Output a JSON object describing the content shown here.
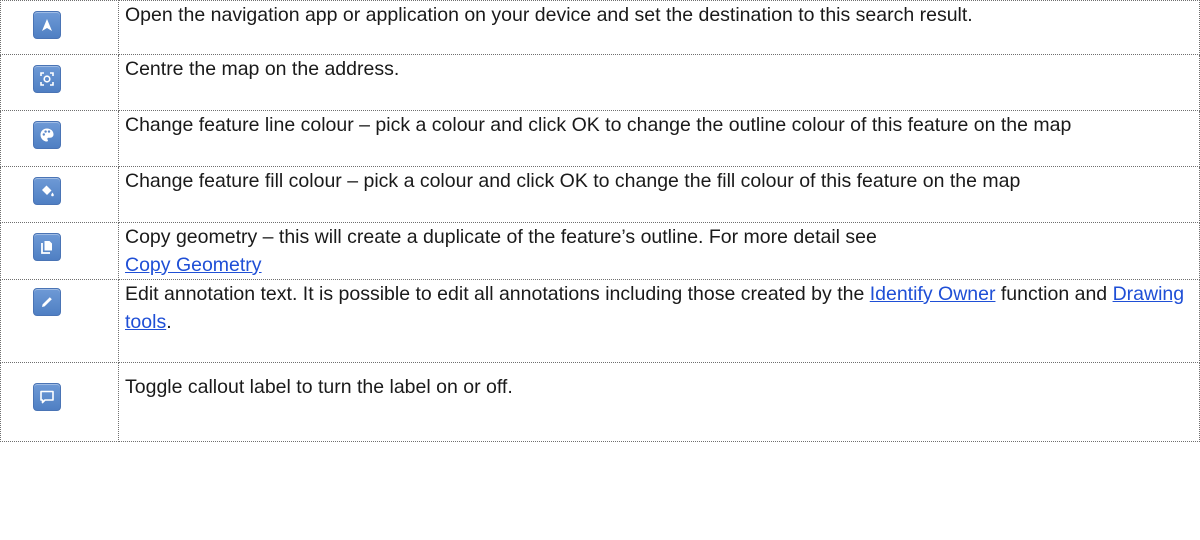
{
  "rows": [
    {
      "icon": "navigate-icon",
      "text": "Open the navigation app or application on your device and set the destination to this search result."
    },
    {
      "icon": "center-map-icon",
      "text": "Centre the map on the address."
    },
    {
      "icon": "line-colour-palette-icon",
      "text": "Change feature line colour – pick a colour and click OK to change the outline colour of this feature on the map"
    },
    {
      "icon": "fill-bucket-icon",
      "text": "Change feature fill colour – pick a colour and click OK to change the fill colour of this feature on the map"
    },
    {
      "icon": "copy-geometry-icon",
      "text": "Copy geometry – this will create a duplicate of the feature’s outline. For more detail see ",
      "link": "Copy Geometry"
    },
    {
      "icon": "edit-pencil-icon",
      "text_before": "Edit annotation text. It is possible to edit all annotations including those created by the ",
      "link1": "Identify Owner",
      "text_middle": " function and ",
      "link2": "Drawing tools",
      "text_after": "."
    },
    {
      "icon": "callout-label-icon",
      "text": "Toggle callout label to turn the label on or off."
    }
  ]
}
